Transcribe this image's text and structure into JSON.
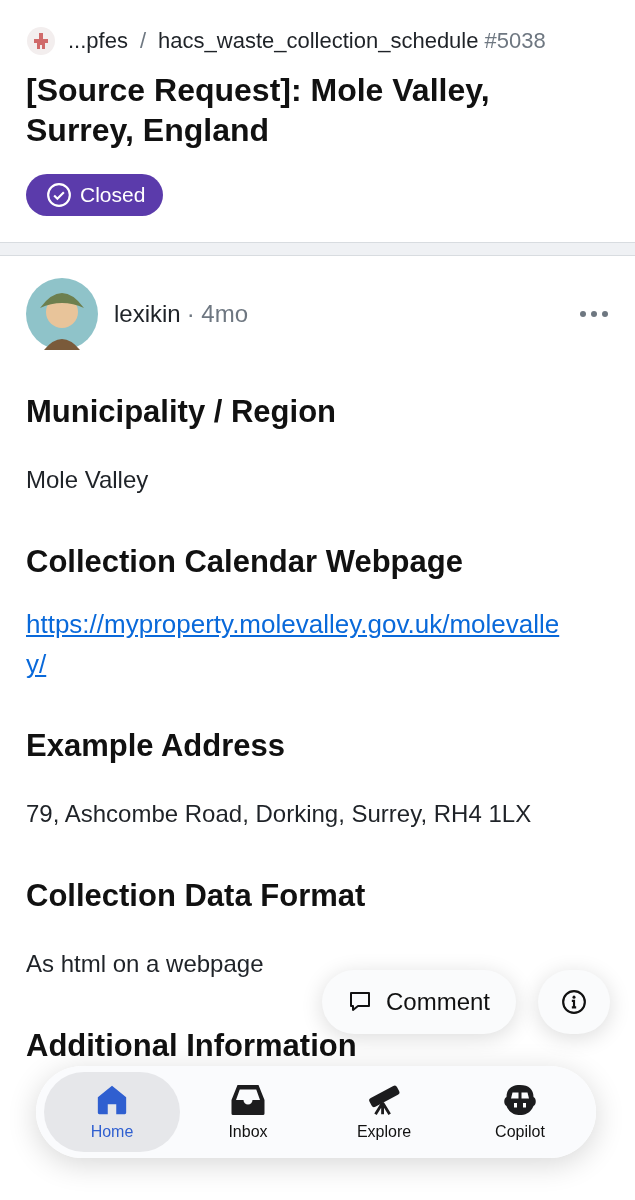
{
  "header": {
    "owner": "...pfes",
    "separator": "/",
    "repo": "hacs_waste_collection_schedule",
    "number": "#5038",
    "title": "[Source Request]: Mole Valley, Surrey, England",
    "status": {
      "label": "Closed",
      "kind": "closed"
    }
  },
  "comment": {
    "author": "lexikin",
    "time": "· 4mo",
    "sections": [
      {
        "heading": "Municipality / Region",
        "body": "Mole Valley",
        "kind": "text"
      },
      {
        "heading": "Collection Calendar Webpage",
        "body": "https://myproperty.molevalley.gov.uk/molevalley/",
        "kind": "link"
      },
      {
        "heading": "Example Address",
        "body": "79, Ashcombe Road, Dorking, Surrey, RH4 1LX",
        "kind": "text"
      },
      {
        "heading": "Collection Data Format",
        "body": "As html on a webpage",
        "kind": "text"
      },
      {
        "heading": "Additional Information"
      }
    ]
  },
  "actions": {
    "comment": "Comment"
  },
  "nav": [
    {
      "label": "Home",
      "kind": "home",
      "selected": true
    },
    {
      "label": "Inbox",
      "kind": "inbox",
      "selected": false
    },
    {
      "label": "Explore",
      "kind": "telescope",
      "selected": false
    },
    {
      "label": "Copilot",
      "kind": "copilot",
      "selected": false
    }
  ]
}
